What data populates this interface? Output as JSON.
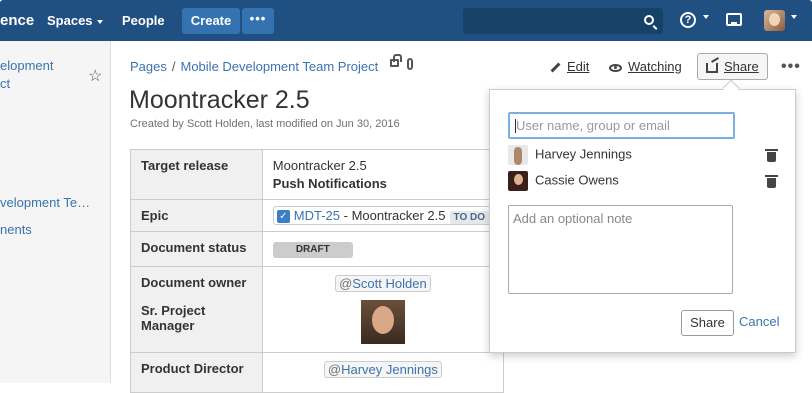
{
  "topnav": {
    "logo": "ence",
    "spaces": "Spaces",
    "people": "People",
    "create": "Create",
    "more": "•••"
  },
  "sidebar": {
    "items": [
      {
        "label": "elopment"
      },
      {
        "label": "ct"
      },
      {
        "label": "velopment Te…"
      },
      {
        "label": "nents"
      }
    ]
  },
  "breadcrumb": {
    "pages": "Pages",
    "separator": "/",
    "space": "Mobile Development Team Project"
  },
  "page": {
    "title": "Moontracker 2.5",
    "byline": "Created by Scott Holden, last modified on Jun 30, 2016"
  },
  "table": {
    "rows": [
      {
        "label": "Target release",
        "value1": "Moontracker 2.5",
        "value2": "Push Notifications"
      },
      {
        "label": "Epic",
        "jira_key": "MDT-25",
        "jira_summary": " - Moontracker 2.5",
        "jira_status": "TO DO"
      },
      {
        "label": "Document status",
        "status": "DRAFT"
      },
      {
        "label": "Document owner",
        "label2": "Sr. Project Manager",
        "mention": "Scott Holden"
      },
      {
        "label": "Product Director",
        "mention": "Harvey Jennings"
      }
    ],
    "at": "@"
  },
  "toolbar": {
    "edit": "Edit",
    "watching": "Watching",
    "share": "Share",
    "more": "•••"
  },
  "share_popup": {
    "input_placeholder": "User name, group or email",
    "people": [
      {
        "name": "Harvey Jennings"
      },
      {
        "name": "Cassie Owens"
      }
    ],
    "note_placeholder": "Add an optional note",
    "share_button": "Share",
    "cancel_link": "Cancel"
  }
}
